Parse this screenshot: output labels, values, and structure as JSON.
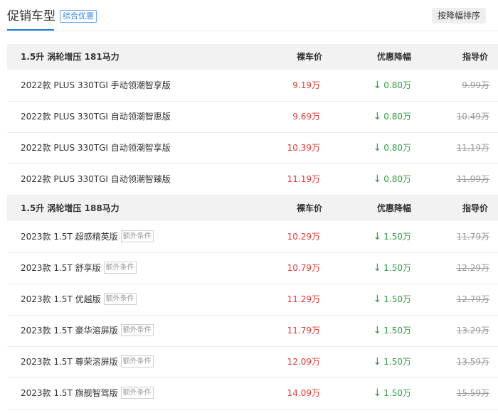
{
  "header": {
    "title": "促销车型",
    "tag": "综合优惠",
    "sort_button": "按降幅排序"
  },
  "groups": [
    {
      "title": "1.5升 涡轮增压 181马力",
      "col_price": "裸车价",
      "col_discount": "优惠降幅",
      "col_guide": "指导价",
      "rows": [
        {
          "name": "2022款 PLUS 330TGI 手动领潮智享版",
          "badge": "",
          "price": "9.19万",
          "discount": "0.80万",
          "guide": "9.99万"
        },
        {
          "name": "2022款 PLUS 330TGI 自动领潮智惠版",
          "badge": "",
          "price": "9.69万",
          "discount": "0.80万",
          "guide": "10.49万"
        },
        {
          "name": "2022款 PLUS 330TGI 自动领潮智享版",
          "badge": "",
          "price": "10.39万",
          "discount": "0.80万",
          "guide": "11.19万"
        },
        {
          "name": "2022款 PLUS 330TGI 自动领潮智臻版",
          "badge": "",
          "price": "11.19万",
          "discount": "0.80万",
          "guide": "11.99万"
        }
      ]
    },
    {
      "title": "1.5升 涡轮增压 188马力",
      "col_price": "裸车价",
      "col_discount": "优惠降幅",
      "col_guide": "指导价",
      "rows": [
        {
          "name": "2023款 1.5T 超感精英版",
          "badge": "额外条件",
          "price": "10.29万",
          "discount": "1.50万",
          "guide": "11.79万"
        },
        {
          "name": "2023款 1.5T 舒享版",
          "badge": "额外条件",
          "price": "10.79万",
          "discount": "1.50万",
          "guide": "12.29万"
        },
        {
          "name": "2023款 1.5T 优越版",
          "badge": "额外条件",
          "price": "11.29万",
          "discount": "1.50万",
          "guide": "12.79万"
        },
        {
          "name": "2023款 1.5T 豪华溶屏版",
          "badge": "额外条件",
          "price": "11.79万",
          "discount": "1.50万",
          "guide": "13.29万"
        },
        {
          "name": "2023款 1.5T 尊荣溶屏版",
          "badge": "额外条件",
          "price": "12.09万",
          "discount": "1.50万",
          "guide": "13.59万"
        },
        {
          "name": "2023款 1.5T 旗舰智驾版",
          "badge": "额外条件",
          "price": "14.09万",
          "discount": "1.50万",
          "guide": "15.59万"
        }
      ]
    }
  ],
  "colors": {
    "price": "#e53935",
    "discount": "#2f9e44",
    "accent": "#1f7fe0"
  },
  "icons": {
    "discount_arrow": "down-arrow-icon"
  }
}
